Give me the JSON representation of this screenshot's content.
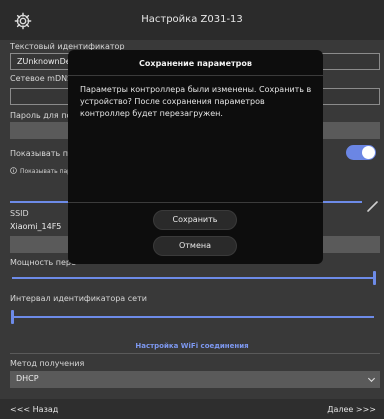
{
  "header": {
    "title": "Настройка Z031-13",
    "settings_icon": "gear-icon"
  },
  "form": {
    "text_id": {
      "label": "Текстовый идентификатор",
      "value": "ZUnknownDev"
    },
    "mdns": {
      "label": "Сетевое mDNS",
      "value": ""
    },
    "password": {
      "label": "Пароль для по",
      "value": ""
    },
    "show_password": {
      "label": "Показывать па",
      "hint": "Показывать пар",
      "hint_icon": "info-icon",
      "on": true
    },
    "ssid": {
      "label": "SSID",
      "value": "Xiaomi_14F5",
      "edit_icon": "pencil-icon"
    },
    "tx_power": {
      "label": "Мощность пере",
      "level": 1.0
    },
    "net_id_interval": {
      "label": "Интервал идентификатора сети",
      "level": 0.0
    },
    "wifi_section": "Настройка WiFi соединения",
    "method": {
      "label": "Метод получения",
      "value": "DHCP",
      "icon": "chevron-down-icon"
    }
  },
  "nav": {
    "back": "<<< Назад",
    "next": "Далее >>>"
  },
  "dialog": {
    "title": "Сохранение параметров",
    "message": "Параметры контроллера были изменены. Сохранить в устройство? После сохранения параметров контроллер будет перезагружен.",
    "save": "Сохранить",
    "cancel": "Отмена"
  },
  "colors": {
    "accent": "#6d8be8",
    "background": "#393939",
    "dialog": "#0d0d0d"
  }
}
